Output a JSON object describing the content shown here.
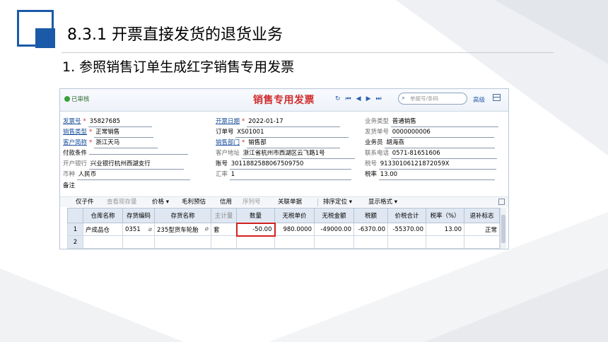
{
  "slide": {
    "title": "8.3.1  开票直接发货的退货业务",
    "subtitle": "1. 参照销售订单生成红字销售专用发票"
  },
  "window": {
    "status": "已审核",
    "doc_title": "销售专用发票",
    "nav_icons": [
      "refresh-icon",
      "first-icon",
      "prev-icon",
      "next-icon",
      "last-icon"
    ],
    "search_placeholder": "单据号/条码",
    "advanced_label": "高级"
  },
  "header_fields": {
    "invoice_no": {
      "label": "发票号",
      "value": "35827685"
    },
    "invoice_date": {
      "label": "开票日期",
      "value": "2022-01-17"
    },
    "biz_type": {
      "label": "业务类型",
      "value": "普通销售"
    },
    "sales_type": {
      "label": "销售类型",
      "value": "正常销售"
    },
    "order_no": {
      "label": "订单号",
      "value": "XS01001"
    },
    "ship_no": {
      "label": "发货单号",
      "value": "0000000006"
    },
    "customer": {
      "label": "客户简称",
      "value": "浙江天马"
    },
    "dept": {
      "label": "销售部门",
      "value": "销售部"
    },
    "salesperson": {
      "label": "业务员",
      "value": "胡海燕"
    },
    "pay_terms": {
      "label": "付款条件",
      "value": ""
    },
    "cust_addr": {
      "label": "客户地址",
      "value": "浙江省杭州市西湖区云飞路1号"
    },
    "phone": {
      "label": "联系电话",
      "value": "0571-81651606"
    },
    "bank": {
      "label": "开户银行",
      "value": "兴业银行杭州西湖支行"
    },
    "account": {
      "label": "账号",
      "value": "3011882588067509750"
    },
    "tax_no": {
      "label": "税号",
      "value": "91330106121872059X"
    },
    "currency": {
      "label": "币种",
      "value": "人民币"
    },
    "rate": {
      "label": "汇率",
      "value": "1"
    },
    "tax_rate": {
      "label": "税率",
      "value": "13.00"
    },
    "remark": {
      "label": "备注",
      "value": ""
    }
  },
  "toolbar": {
    "sub_items": "仅子件",
    "view_stock": "查看现存量",
    "price": "价格",
    "gross_profit": "毛利预估",
    "credit": "信用",
    "serial": "序列号",
    "linked_docs": "关联单据",
    "sort": "排序定位",
    "display_format": "显示格式"
  },
  "table": {
    "headers": [
      "",
      "仓库名称",
      "存货编码",
      "存货名称",
      "主计量",
      "数量",
      "无税单价",
      "无税金额",
      "税额",
      "价税合计",
      "税率（%）",
      "退补标志"
    ],
    "rows": [
      [
        "1",
        "产成品仓",
        "0351",
        "235型货车轮胎",
        "套",
        "-50.00",
        "980.0000",
        "-49000.00",
        "-6370.00",
        "-55370.00",
        "13.00",
        "正常"
      ],
      [
        "2",
        "",
        "",
        "",
        "",
        "",
        "",
        "",
        "",
        "",
        "",
        ""
      ]
    ]
  },
  "colors": {
    "accent_blue": "#1a5aa8",
    "doc_title_red": "#d12a2a",
    "highlight_red": "#d42020"
  }
}
